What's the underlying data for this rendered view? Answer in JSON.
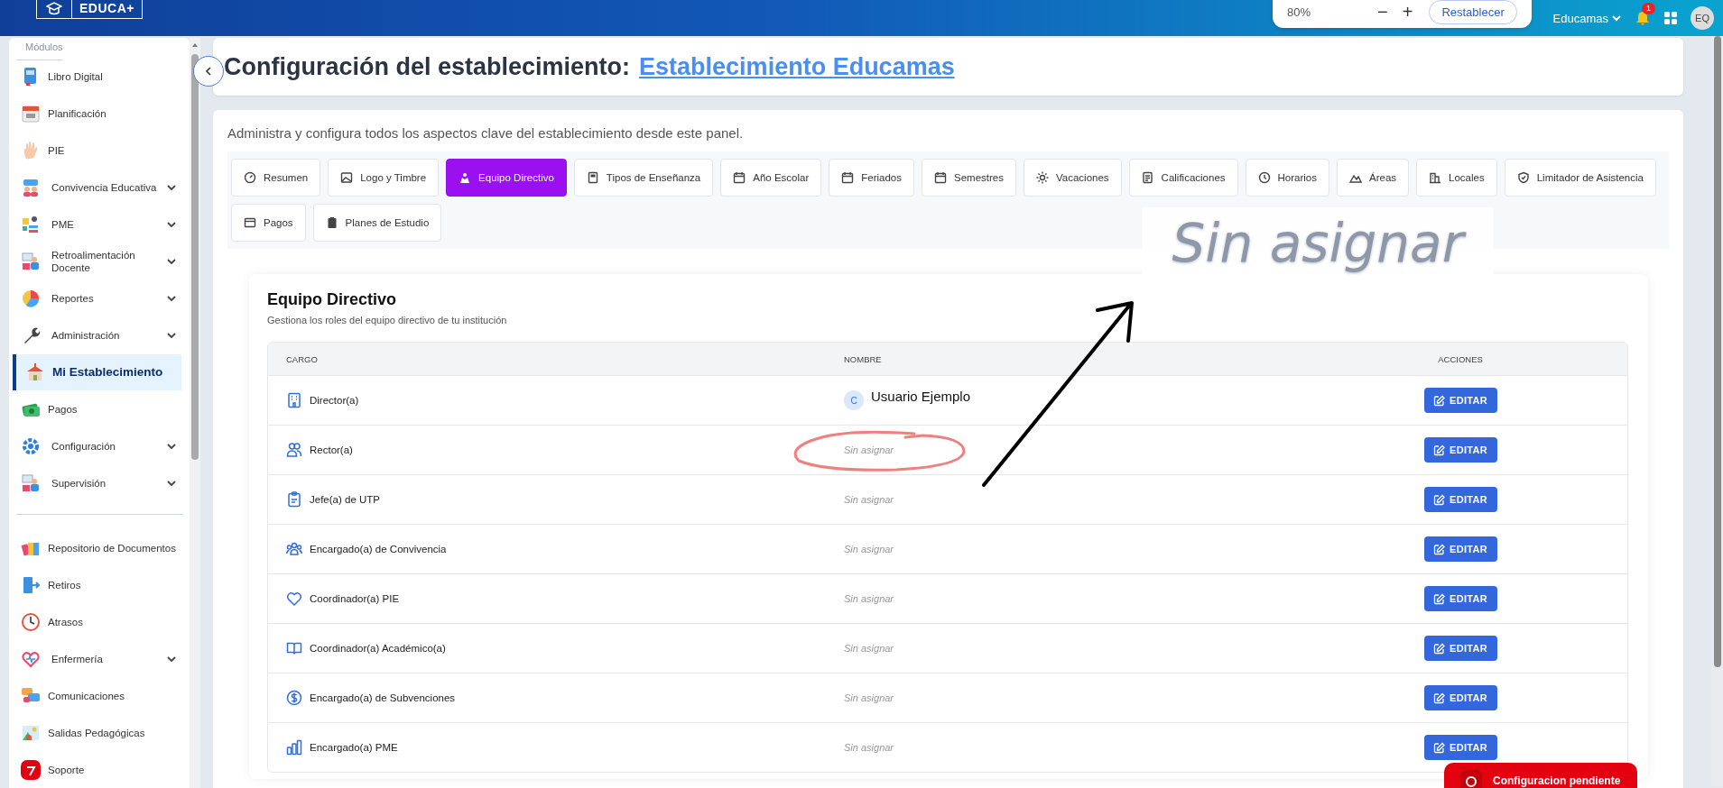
{
  "topbar": {
    "logo_text": "EDUCA+",
    "zoom": {
      "value": "80%",
      "decrease": "−",
      "increase": "+",
      "reset": "Restablecer"
    },
    "school": "Educamas",
    "notification_count": "1",
    "user_initials": "EQ"
  },
  "sidebar": {
    "section_title": "Módulos",
    "items": [
      {
        "label": "Libro Digital",
        "kind": "link",
        "selected": false
      },
      {
        "label": "Planificación",
        "kind": "link",
        "selected": false
      },
      {
        "label": "PIE",
        "kind": "link",
        "selected": false
      },
      {
        "label": "Convivencia Educativa",
        "kind": "group",
        "selected": false
      },
      {
        "label": "PME",
        "kind": "group",
        "selected": false
      },
      {
        "label": "Retroalimentación Docente",
        "kind": "group",
        "selected": false
      },
      {
        "label": "Reportes",
        "kind": "group",
        "selected": false
      },
      {
        "label": "Administración",
        "kind": "group",
        "selected": false
      },
      {
        "label": "Mi Establecimiento",
        "kind": "link",
        "selected": true
      },
      {
        "label": "Pagos",
        "kind": "link",
        "selected": false
      },
      {
        "label": "Configuración",
        "kind": "group",
        "selected": false
      },
      {
        "label": "Supervisión",
        "kind": "group",
        "selected": false
      }
    ],
    "secondary_items": [
      {
        "label": "Repositorio de Documentos",
        "kind": "link",
        "selected": false
      },
      {
        "label": "Retiros",
        "kind": "link",
        "selected": false
      },
      {
        "label": "Atrasos",
        "kind": "link",
        "selected": false
      },
      {
        "label": "Enfermería",
        "kind": "group",
        "selected": false
      },
      {
        "label": "Comunicaciones",
        "kind": "link",
        "selected": false
      },
      {
        "label": "Salidas Pedagógicas",
        "kind": "link",
        "selected": false
      },
      {
        "label": "Soporte",
        "kind": "link",
        "selected": false
      }
    ]
  },
  "header": {
    "title": "Configuración del establecimiento:",
    "link": "Establecimiento Educamas"
  },
  "panel": {
    "description": "Administra y configura todos los aspectos clave del establecimiento desde este panel.",
    "tab_rows": [
      [
        {
          "label": "Resumen",
          "selected": false
        },
        {
          "label": "Logo y Timbre",
          "selected": false
        },
        {
          "label": "Equipo Directivo",
          "selected": true
        },
        {
          "label": "Tipos de Enseñanza",
          "selected": false
        },
        {
          "label": "Año Escolar",
          "selected": false
        },
        {
          "label": "Feriados",
          "selected": false
        },
        {
          "label": "Semestres",
          "selected": false
        },
        {
          "label": "Vacaciones",
          "selected": false
        },
        {
          "label": "Calificaciones",
          "selected": false
        },
        {
          "label": "Horarios",
          "selected": false
        },
        {
          "label": "Áreas",
          "selected": false
        },
        {
          "label": "Locales",
          "selected": false
        },
        {
          "label": "Limitador de Asistencia",
          "selected": false
        }
      ],
      [
        {
          "label": "Pagos",
          "selected": false
        },
        {
          "label": "Planes de Estudio",
          "selected": false
        }
      ]
    ]
  },
  "callout": {
    "text": "Sin asignar"
  },
  "team": {
    "title": "Equipo Directivo",
    "subtitle": "Gestiona los roles del equipo directivo de tu institución",
    "columns": [
      "CARGO",
      "NOMBRE",
      "ACCIONES"
    ],
    "rows": [
      {
        "role": "Director(a)",
        "kind": "assigned",
        "avatar": "C",
        "name": "Usuario Ejemplo",
        "action": "EDITAR",
        "circled": false
      },
      {
        "role": "Rector(a)",
        "kind": "unassigned",
        "name": "Sin asignar",
        "action": "EDITAR",
        "circled": true
      },
      {
        "role": "Jefe(a) de UTP",
        "kind": "unassigned",
        "name": "Sin asignar",
        "action": "EDITAR",
        "circled": false
      },
      {
        "role": "Encargado(a) de Convivencia",
        "kind": "unassigned",
        "name": "Sin asignar",
        "action": "EDITAR",
        "circled": false
      },
      {
        "role": "Coordinador(a) PIE",
        "kind": "unassigned",
        "name": "Sin asignar",
        "action": "EDITAR",
        "circled": false
      },
      {
        "role": "Coordinador(a) Académico(a)",
        "kind": "unassigned",
        "name": "Sin asignar",
        "action": "EDITAR",
        "circled": false
      },
      {
        "role": "Encargado(a) de Subvenciones",
        "kind": "unassigned",
        "name": "Sin asignar",
        "action": "EDITAR",
        "circled": false
      },
      {
        "role": "Encargado(a) PME",
        "kind": "unassigned",
        "name": "Sin asignar",
        "action": "EDITAR",
        "circled": false
      }
    ]
  },
  "pending_button": {
    "label": "Configuracion pendiente"
  }
}
